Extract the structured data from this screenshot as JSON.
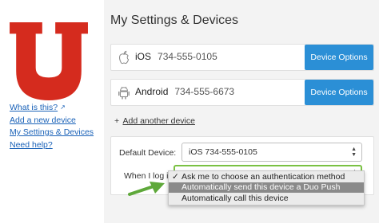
{
  "sidebar": {
    "links": [
      {
        "label": "What is this?",
        "external": true
      },
      {
        "label": "Add a new device"
      },
      {
        "label": "My Settings & Devices"
      },
      {
        "label": "Need help?"
      }
    ]
  },
  "page": {
    "title": "My Settings & Devices"
  },
  "devices": [
    {
      "icon": "apple-icon",
      "name": "iOS",
      "number": "734-555-0105",
      "button": "Device Options"
    },
    {
      "icon": "android-icon",
      "name": "Android",
      "number": "734-555-6673",
      "button": "Device Options"
    }
  ],
  "add_device": {
    "prefix": "+",
    "label": "Add another device"
  },
  "settings": {
    "default_device_label": "Default Device:",
    "default_device_value": "iOS 734-555-0105",
    "login_label": "When I log in:",
    "login_options": [
      {
        "label": "Ask me to choose an authentication method",
        "checked": true
      },
      {
        "label": "Automatically send this device a Duo Push",
        "highlighted": true
      },
      {
        "label": "Automatically call this device"
      }
    ],
    "checkmark": "✓"
  },
  "colors": {
    "logo_red": "#d52b1e",
    "button_blue": "#2b8fd6",
    "link_blue": "#1a62b8",
    "arrow_green": "#5ea83a",
    "highlight_gray": "#8a8a8a"
  }
}
